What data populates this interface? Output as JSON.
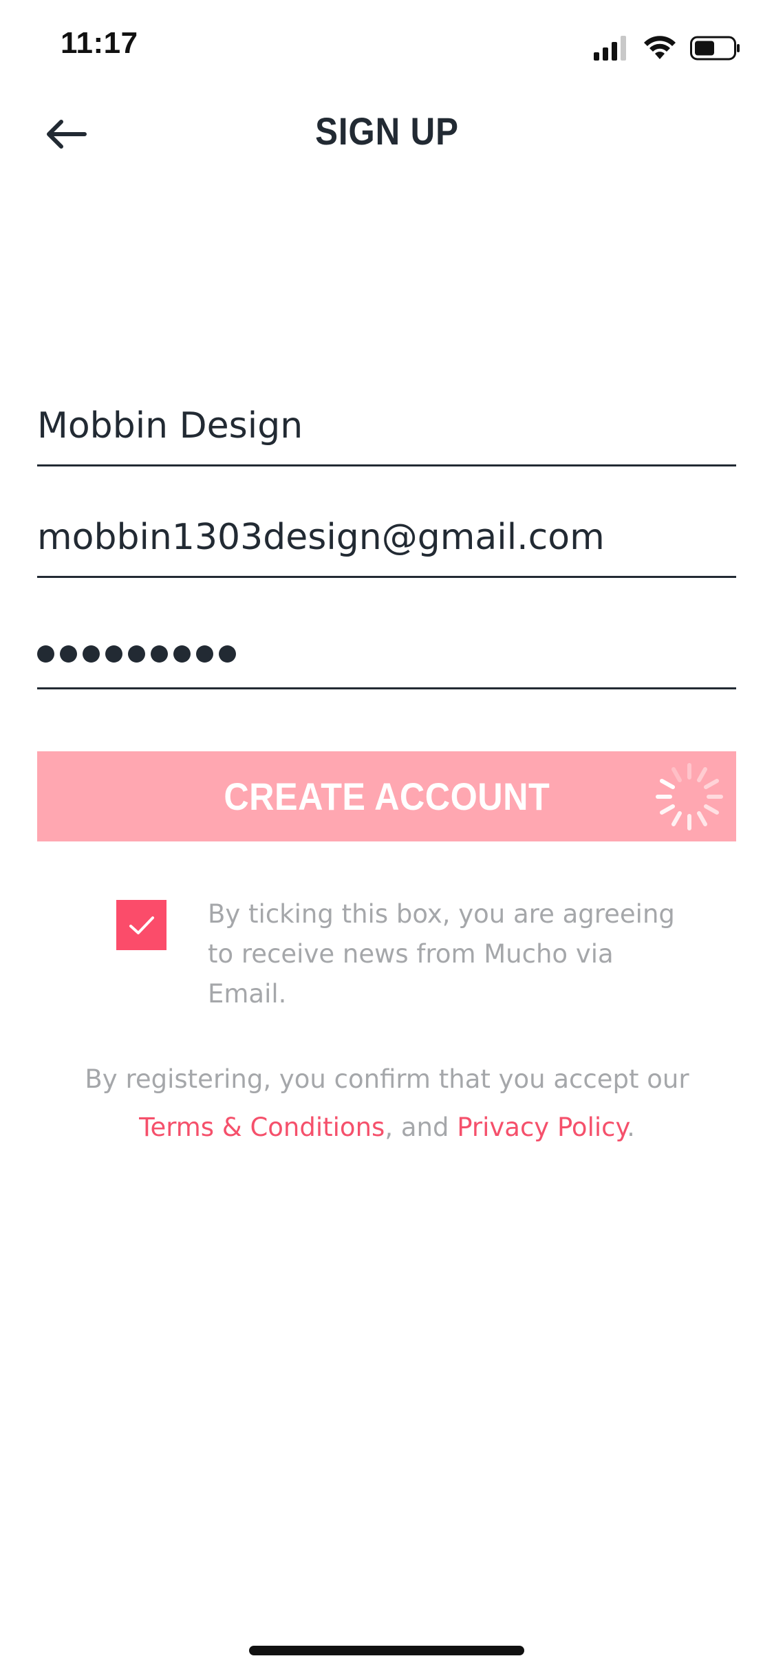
{
  "status_bar": {
    "time": "11:17",
    "icons": [
      "cellular-signal-icon",
      "wifi-icon",
      "battery-icon"
    ]
  },
  "header": {
    "title": "SIGN UP",
    "back_icon": "arrow-left-icon"
  },
  "form": {
    "name_value": "Mobbin Design",
    "email_value": "mobbin1303design@gmail.com",
    "password_masked": "●●●●●●●●●"
  },
  "create_button": {
    "label": "CREATE ACCOUNT",
    "loading": true
  },
  "consent": {
    "checked": true,
    "text_line1": "By ticking this box, you are agreeing",
    "text_line2": "to receive news from Mucho via Email."
  },
  "legal": {
    "line1": "By registering, you confirm that you accept our",
    "terms_link": "Terms & Conditions",
    "separator": ", and ",
    "privacy_link": "Privacy Policy",
    "end": "."
  },
  "colors": {
    "accent": "#fb4c6a",
    "button_disabled": "#ffa7b1",
    "text_dark": "#222a33",
    "text_muted": "#a5a7aa",
    "link": "#f5506b"
  }
}
